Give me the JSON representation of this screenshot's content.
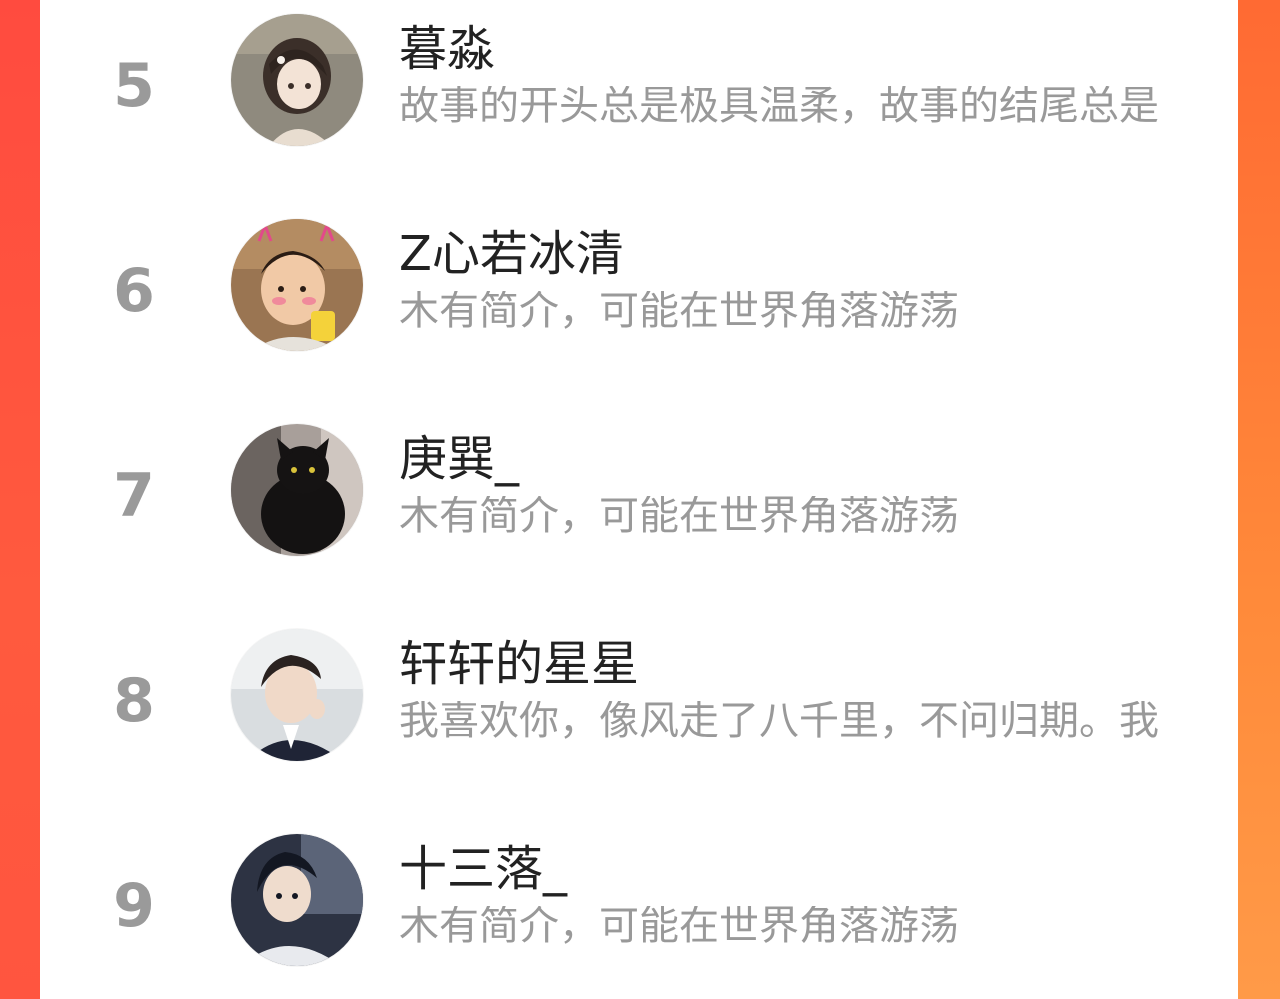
{
  "ranking": {
    "items": [
      {
        "rank": "5",
        "name": "暮淼",
        "bio": "故事的开头总是极具温柔，故事的结尾总是"
      },
      {
        "rank": "6",
        "name": "Z心若冰清",
        "bio": "木有简介，可能在世界角落游荡"
      },
      {
        "rank": "7",
        "name": "庚巽_",
        "bio": "木有简介，可能在世界角落游荡"
      },
      {
        "rank": "8",
        "name": "轩轩的星星",
        "bio": "我喜欢你，像风走了八千里，不问归期。我"
      },
      {
        "rank": "9",
        "name": "十三落_",
        "bio": "木有简介，可能在世界角落游荡"
      }
    ]
  },
  "colors": {
    "accent_left": "#ff4b3f",
    "accent_right": "#ff8a3a",
    "rank_text": "#9a9a9a",
    "name_text": "#222222",
    "bio_text": "#999999"
  },
  "icons": {
    "avatar_5": "anime-girl-avatar",
    "avatar_6": "child-photo-avatar",
    "avatar_7": "black-cat-avatar",
    "avatar_8": "young-man-avatar",
    "avatar_9": "anime-boy-avatar"
  }
}
